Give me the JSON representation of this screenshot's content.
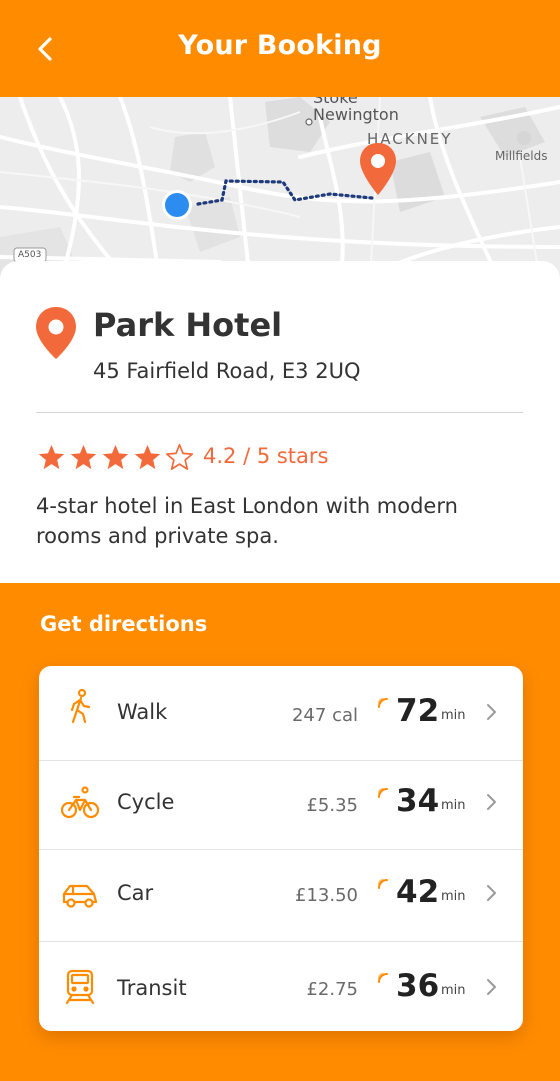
{
  "header": {
    "title": "Your Booking",
    "back_icon": "chevron-left-icon"
  },
  "map": {
    "labels": {
      "area_1_line1": "Stoke",
      "area_1_line2": "Newington",
      "area_2": "HACKNEY",
      "area_3": "Millfields",
      "road": "A503"
    },
    "origin_color": "#2D8CF0",
    "route_color": "#1F3A7A",
    "destination_color": "#F26A3B"
  },
  "hotel": {
    "name": "Park Hotel",
    "address": "45 Fairfield Road, E3 2UQ",
    "rating": 4.2,
    "rating_text": "4.2 / 5 stars",
    "stars_filled": 4,
    "stars_total": 5,
    "description": "4-star hotel in East London with modern rooms and private spa."
  },
  "directions": {
    "title": "Get directions",
    "modes": [
      {
        "label": "Walk",
        "cost": "247 cal",
        "time": "72",
        "unit": "min",
        "icon": "walk-icon"
      },
      {
        "label": "Cycle",
        "cost": "£5.35",
        "time": "34",
        "unit": "min",
        "icon": "bicycle-icon"
      },
      {
        "label": "Car",
        "cost": "£13.50",
        "time": "42",
        "unit": "min",
        "icon": "car-icon"
      },
      {
        "label": "Transit",
        "cost": "£2.75",
        "time": "36",
        "unit": "min",
        "icon": "train-icon"
      }
    ]
  },
  "colors": {
    "accent": "#FF8C00",
    "pin": "#F26A3B",
    "star": "#F26A3B"
  }
}
